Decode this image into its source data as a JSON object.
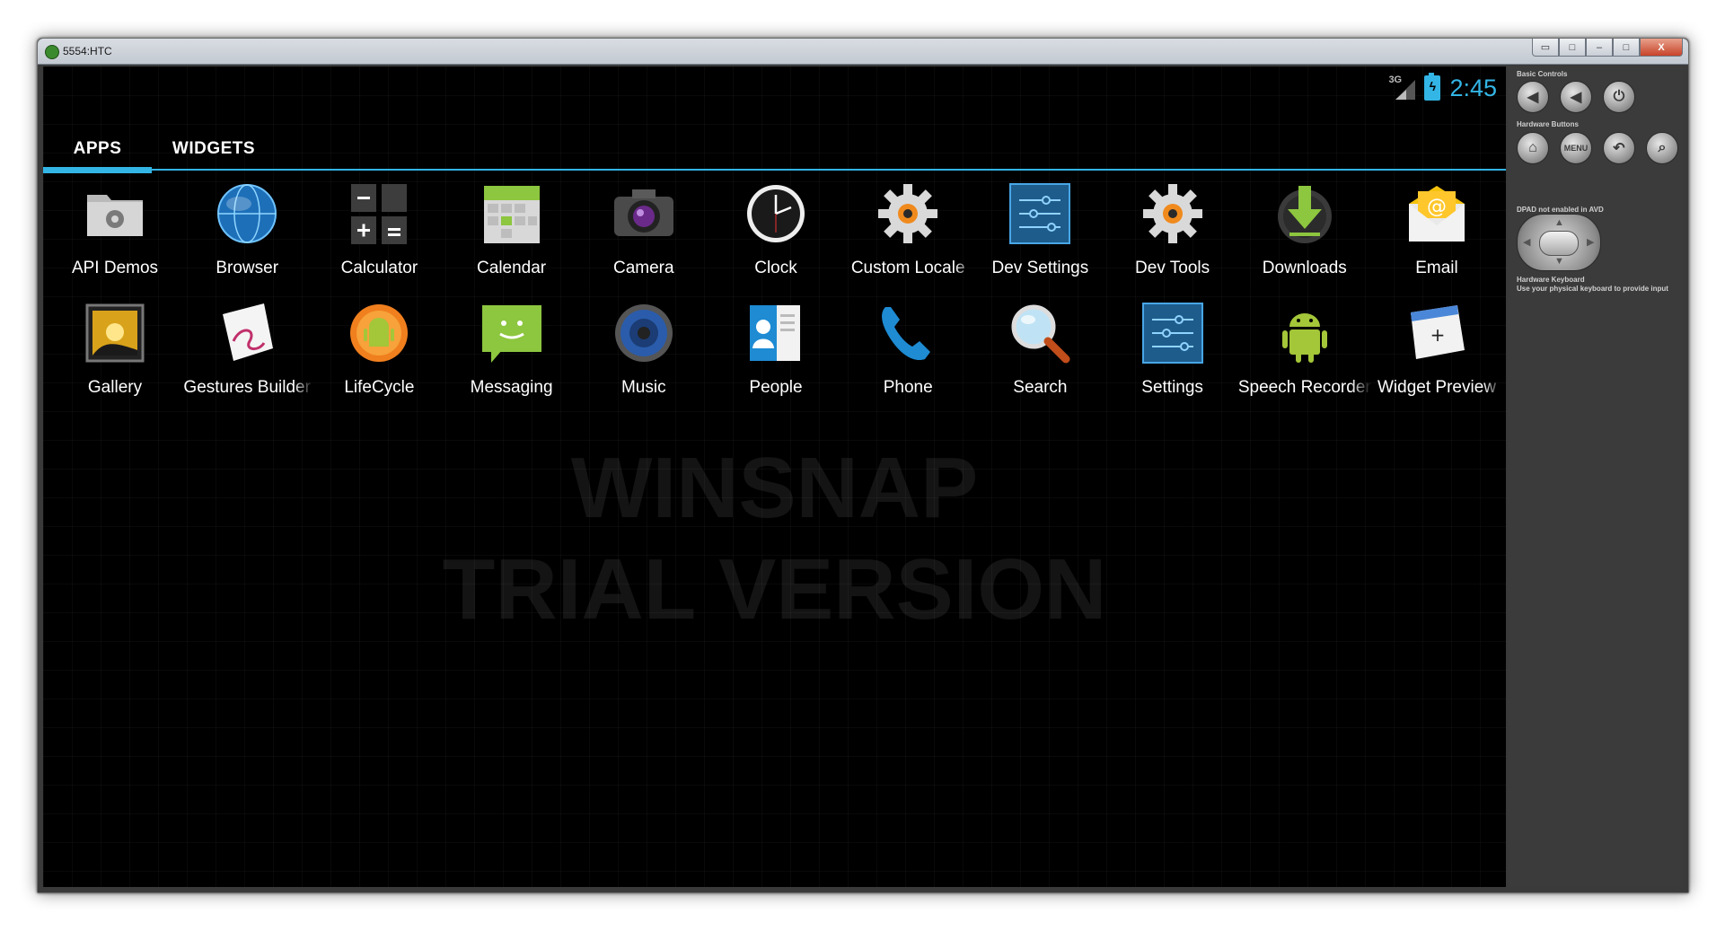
{
  "window": {
    "title": "5554:HTC",
    "buttons": [
      "▭",
      "□",
      "–",
      "□",
      "X"
    ]
  },
  "status": {
    "network": "3G",
    "time": "2:45",
    "accent": "#33b5e5"
  },
  "tabs": [
    "APPS",
    "WIDGETS"
  ],
  "apps": [
    {
      "label": "API Demos",
      "icon": "folder-gear-icon"
    },
    {
      "label": "Browser",
      "icon": "globe-icon"
    },
    {
      "label": "Calculator",
      "icon": "calculator-icon"
    },
    {
      "label": "Calendar",
      "icon": "calendar-icon"
    },
    {
      "label": "Camera",
      "icon": "camera-icon"
    },
    {
      "label": "Clock",
      "icon": "clock-icon"
    },
    {
      "label": "Custom Locale",
      "icon": "gear-icon"
    },
    {
      "label": "Dev Settings",
      "icon": "sliders-icon"
    },
    {
      "label": "Dev Tools",
      "icon": "gear-icon"
    },
    {
      "label": "Downloads",
      "icon": "download-icon"
    },
    {
      "label": "Email",
      "icon": "email-icon"
    },
    {
      "label": "Gallery",
      "icon": "gallery-icon"
    },
    {
      "label": "Gestures Builder",
      "icon": "gestures-icon"
    },
    {
      "label": "LifeCycle",
      "icon": "android-cube-icon"
    },
    {
      "label": "Messaging",
      "icon": "message-icon"
    },
    {
      "label": "Music",
      "icon": "speaker-icon"
    },
    {
      "label": "People",
      "icon": "contacts-icon"
    },
    {
      "label": "Phone",
      "icon": "phone-icon"
    },
    {
      "label": "Search",
      "icon": "magnifier-icon"
    },
    {
      "label": "Settings",
      "icon": "sliders-icon"
    },
    {
      "label": "Speech Recorder",
      "icon": "android-icon"
    },
    {
      "label": "Widget Preview",
      "icon": "widget-icon"
    }
  ],
  "watermark": [
    "WINSNAP",
    "TRIAL VERSION"
  ],
  "panel": {
    "basic_controls": "Basic Controls",
    "hardware_buttons": "Hardware Buttons",
    "menu_label": "MENU",
    "dpad_note": "DPAD not enabled in AVD",
    "keyboard_title": "Hardware Keyboard",
    "keyboard_note": "Use your physical keyboard to provide input"
  }
}
